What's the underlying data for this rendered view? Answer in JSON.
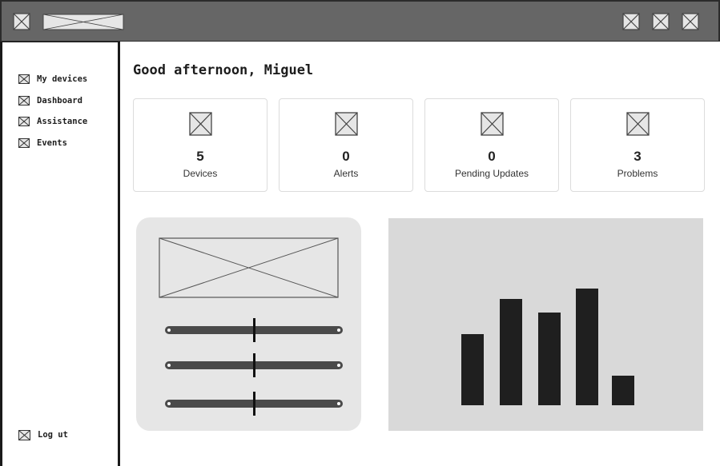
{
  "header": {
    "logo_icon": "image-placeholder-icon",
    "title_placeholder": "image-placeholder",
    "actions": [
      "placeholder-icon",
      "placeholder-icon",
      "placeholder-icon"
    ]
  },
  "sidebar": {
    "items": [
      {
        "label": "My devices",
        "icon": "image-placeholder-icon"
      },
      {
        "label": "Dashboard",
        "icon": "image-placeholder-icon"
      },
      {
        "label": "Assistance",
        "icon": "image-placeholder-icon"
      },
      {
        "label": "Events",
        "icon": "image-placeholder-icon"
      }
    ],
    "logout_label": "Log ut"
  },
  "main": {
    "greeting": "Good afternoon, Miguel",
    "stats": [
      {
        "value": "5",
        "label": "Devices",
        "icon": "image-placeholder-icon"
      },
      {
        "value": "0",
        "label": "Alerts",
        "icon": "image-placeholder-icon"
      },
      {
        "value": "0",
        "label": "Pending Updates",
        "icon": "image-placeholder-icon"
      },
      {
        "value": "3",
        "label": "Problems",
        "icon": "image-placeholder-icon"
      }
    ],
    "controls": {
      "image": "image-placeholder",
      "sliders": [
        0.5,
        0.5,
        0.5
      ]
    }
  },
  "chart_data": {
    "type": "bar",
    "categories": [
      "",
      "",
      "",
      "",
      ""
    ],
    "values": [
      5.0,
      7.5,
      6.5,
      8.2,
      2.1
    ],
    "title": "",
    "xlabel": "",
    "ylabel": "",
    "ylim": [
      0,
      10
    ],
    "grid": false,
    "color": "#1f1f1f"
  },
  "colors": {
    "header_bg": "#666666",
    "panel_bg": "#e6e6e6",
    "chart_bg": "#d9d9d9",
    "slider_track": "#4a4a4a",
    "bar": "#1f1f1f"
  }
}
